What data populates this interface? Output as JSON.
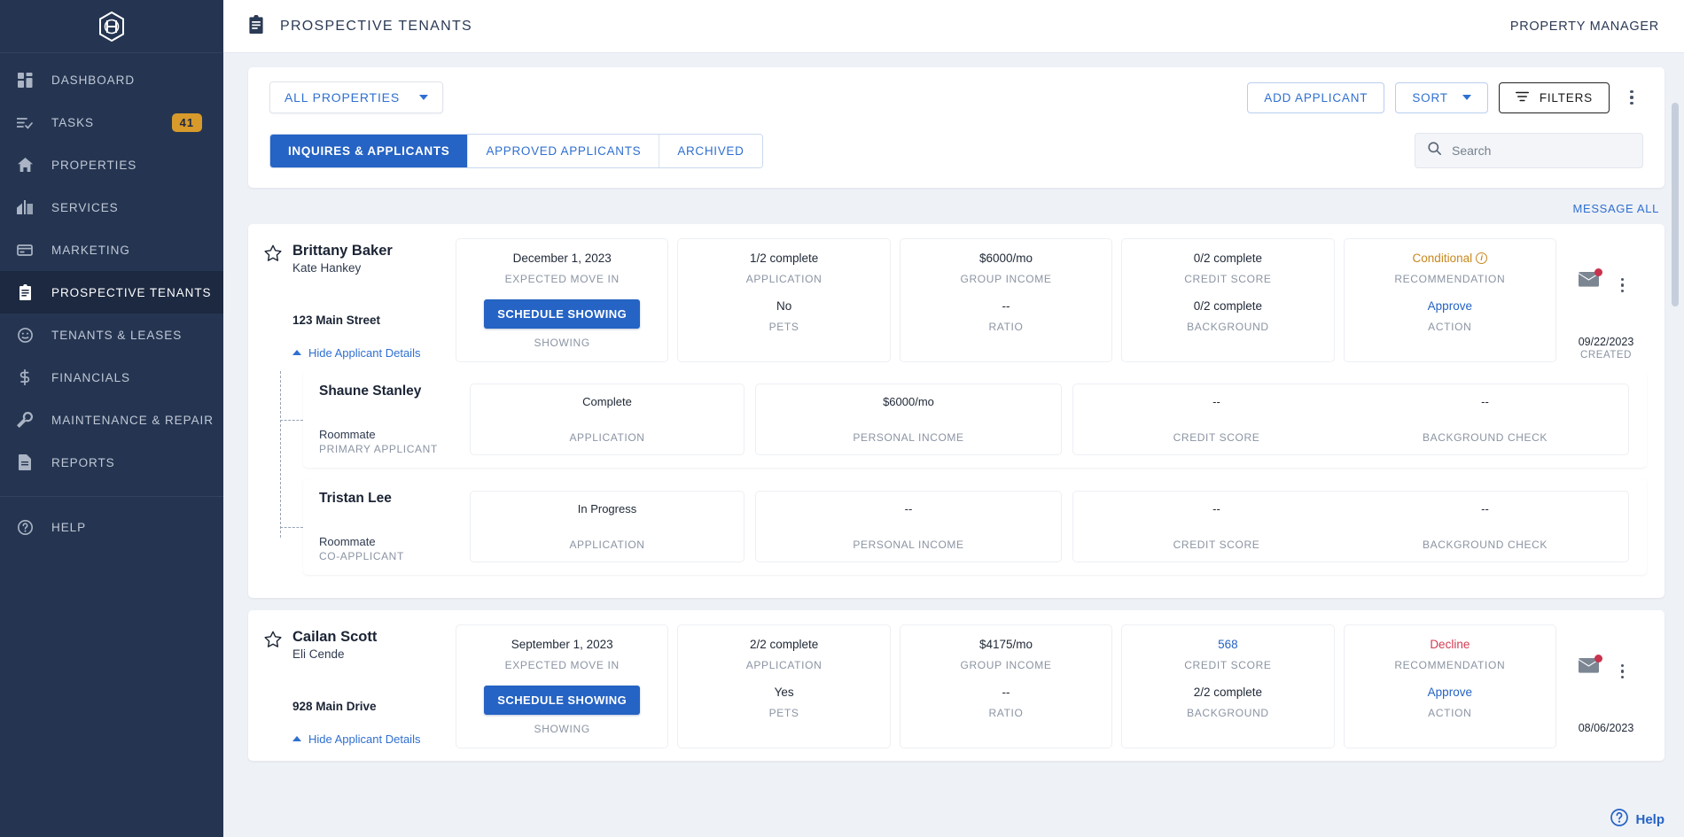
{
  "sidebar": {
    "logo_alt": "hexagon-h-logo",
    "items": [
      {
        "label": "DASHBOARD",
        "icon": "dashboard-icon",
        "badge": null,
        "active": false
      },
      {
        "label": "TASKS",
        "icon": "tasks-icon",
        "badge": "41",
        "active": false
      },
      {
        "label": "PROPERTIES",
        "icon": "home-icon",
        "badge": null,
        "active": false
      },
      {
        "label": "SERVICES",
        "icon": "services-icon",
        "badge": null,
        "active": false
      },
      {
        "label": "MARKETING",
        "icon": "marketing-icon",
        "badge": null,
        "active": false
      },
      {
        "label": "PROSPECTIVE TENANTS",
        "icon": "clipboard-icon",
        "badge": null,
        "active": true
      },
      {
        "label": "TENANTS & LEASES",
        "icon": "face-icon",
        "badge": null,
        "active": false
      },
      {
        "label": "FINANCIALS",
        "icon": "dollar-icon",
        "badge": null,
        "active": false
      },
      {
        "label": "MAINTENANCE & REPAIR",
        "icon": "wrench-icon",
        "badge": null,
        "active": false
      },
      {
        "label": "REPORTS",
        "icon": "report-icon",
        "badge": null,
        "active": false
      }
    ],
    "help": {
      "label": "HELP",
      "icon": "question-circle-icon"
    }
  },
  "header": {
    "title": "PROSPECTIVE TENANTS",
    "icon": "clipboard-icon",
    "account_label": "PROPERTY MANAGER"
  },
  "toolbar": {
    "property_filter": "ALL PROPERTIES",
    "add_applicant": "ADD APPLICANT",
    "sort": "SORT",
    "filters": "FILTERS",
    "overflow_icon": "kebab-menu-icon"
  },
  "tabs": [
    {
      "label": "INQUIRES & APPLICANTS",
      "active": true
    },
    {
      "label": "APPROVED APPLICANTS",
      "active": false
    },
    {
      "label": "ARCHIVED",
      "active": false
    }
  ],
  "search": {
    "placeholder": "Search",
    "value": "",
    "icon": "search-icon"
  },
  "message_all": "MESSAGE ALL",
  "help_fab": {
    "label": "Help",
    "icon": "question-circle-icon"
  },
  "applicants": [
    {
      "name": "Brittany Baker",
      "agent": "Kate Hankey",
      "address": "123 Main Street",
      "toggle_label": "Hide Applicant Details",
      "star_icon": "star-outline-icon",
      "cells": [
        {
          "top_value": "December 1, 2023",
          "top_label": "EXPECTED MOVE IN",
          "bottom_value": "SCHEDULE SHOWING",
          "bottom_value_type": "button",
          "bottom_label": "SHOWING"
        },
        {
          "top_value": "1/2 complete",
          "top_label": "APPLICATION",
          "bottom_value": "No",
          "bottom_value_type": "text",
          "bottom_label": "PETS"
        },
        {
          "top_value": "$6000/mo",
          "top_label": "GROUP INCOME",
          "bottom_value": "--",
          "bottom_value_type": "text",
          "bottom_label": "RATIO"
        },
        {
          "top_value": "0/2 complete",
          "top_label": "CREDIT SCORE",
          "bottom_value": "0/2 complete",
          "bottom_value_type": "text",
          "bottom_label": "BACKGROUND"
        },
        {
          "top_value": "Conditional",
          "top_label": "RECOMMENDATION",
          "top_value_type": "conditional",
          "bottom_value": "Approve",
          "bottom_value_type": "link",
          "bottom_label": "ACTION"
        }
      ],
      "mail_icon": "envelope-icon",
      "mail_has_unread": true,
      "overflow_icon": "kebab-menu-icon",
      "created_date": "09/22/2023",
      "created_label": "CREATED",
      "roommates": [
        {
          "name": "Shaune Stanley",
          "relation": "Roommate",
          "role": "PRIMARY APPLICANT",
          "application_value": "Complete",
          "application_label": "APPLICATION",
          "income_value": "$6000/mo",
          "income_label": "PERSONAL INCOME",
          "credit_value": "--",
          "credit_label": "CREDIT SCORE",
          "background_value": "--",
          "background_label": "BACKGROUND CHECK"
        },
        {
          "name": "Tristan Lee",
          "relation": "Roommate",
          "role": "CO-APPLICANT",
          "application_value": "In Progress",
          "application_label": "APPLICATION",
          "income_value": "--",
          "income_label": "PERSONAL INCOME",
          "credit_value": "--",
          "credit_label": "CREDIT SCORE",
          "background_value": "--",
          "background_label": "BACKGROUND CHECK"
        }
      ]
    },
    {
      "name": "Cailan Scott",
      "agent": "Eli Cende",
      "address": "928 Main Drive",
      "toggle_label": "Hide Applicant Details",
      "star_icon": "star-outline-icon",
      "cells": [
        {
          "top_value": "September 1, 2023",
          "top_label": "EXPECTED MOVE IN",
          "bottom_value": "SCHEDULE SHOWING",
          "bottom_value_type": "button",
          "bottom_label": "SHOWING"
        },
        {
          "top_value": "2/2 complete",
          "top_label": "APPLICATION",
          "bottom_value": "Yes",
          "bottom_value_type": "text",
          "bottom_label": "PETS"
        },
        {
          "top_value": "$4175/mo",
          "top_label": "GROUP INCOME",
          "bottom_value": "--",
          "bottom_value_type": "text",
          "bottom_label": "RATIO"
        },
        {
          "top_value": "568",
          "top_label": "CREDIT SCORE",
          "top_value_type": "link",
          "bottom_value": "2/2 complete",
          "bottom_value_type": "text",
          "bottom_label": "BACKGROUND"
        },
        {
          "top_value": "Decline",
          "top_label": "RECOMMENDATION",
          "top_value_type": "decline",
          "bottom_value": "Approve",
          "bottom_value_type": "link",
          "bottom_label": "ACTION"
        }
      ],
      "mail_icon": "envelope-icon",
      "mail_has_unread": true,
      "overflow_icon": "kebab-menu-icon",
      "created_date": "08/06/2023",
      "created_label": "",
      "roommates": []
    }
  ],
  "colors": {
    "sidebar_bg": "#253551",
    "sidebar_active": "#1c2941",
    "accent_blue": "#2563c4",
    "link_blue": "#2f6fd0",
    "badge_amber": "#d79a2b",
    "conditional": "#c8881d",
    "decline": "#d33b52",
    "page_bg": "#eef1f6"
  }
}
